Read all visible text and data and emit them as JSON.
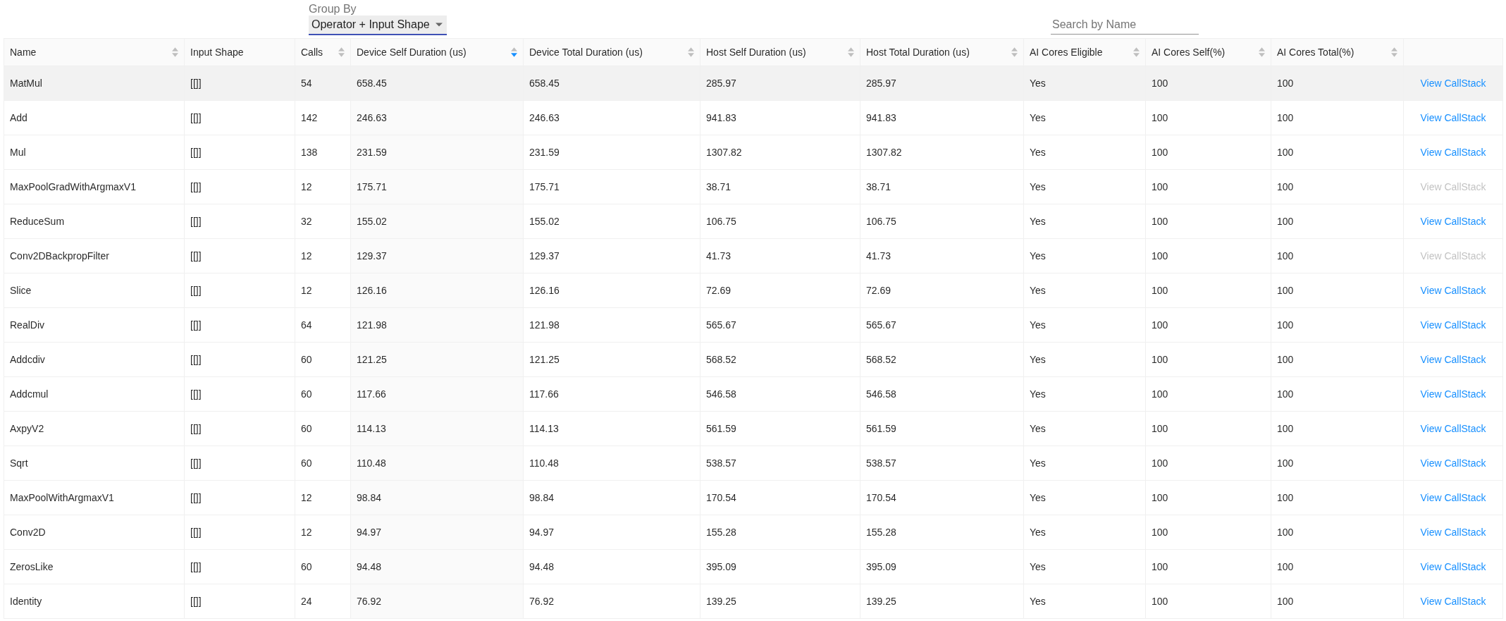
{
  "group_by": {
    "label": "Group By",
    "value": "Operator + Input Shape"
  },
  "search": {
    "placeholder": "Search by Name"
  },
  "table": {
    "columns": [
      {
        "label": "Name",
        "sortable": true,
        "sorted": false
      },
      {
        "label": "Input Shape",
        "sortable": false
      },
      {
        "label": "Calls",
        "sortable": true,
        "sorted": false
      },
      {
        "label": "Device Self Duration (us)",
        "sortable": true,
        "sorted": true
      },
      {
        "label": "Device Total Duration (us)",
        "sortable": true,
        "sorted": false
      },
      {
        "label": "Host Self Duration (us)",
        "sortable": true,
        "sorted": false
      },
      {
        "label": "Host Total Duration (us)",
        "sortable": true,
        "sorted": false
      },
      {
        "label": "AI Cores Eligible",
        "sortable": true,
        "sorted": false
      },
      {
        "label": "AI Cores Self(%)",
        "sortable": true,
        "sorted": false
      },
      {
        "label": "AI Cores Total(%)",
        "sortable": true,
        "sorted": false
      }
    ],
    "rows": [
      {
        "highlighted": true,
        "cells": [
          "MatMul",
          "[[]]",
          "54",
          "658.45",
          "658.45",
          "285.97",
          "285.97",
          "Yes",
          "100",
          "100"
        ],
        "action": {
          "label": "View CallStack",
          "disabled": false
        }
      },
      {
        "highlighted": false,
        "cells": [
          "Add",
          "[[]]",
          "142",
          "246.63",
          "246.63",
          "941.83",
          "941.83",
          "Yes",
          "100",
          "100"
        ],
        "action": {
          "label": "View CallStack",
          "disabled": false
        }
      },
      {
        "highlighted": false,
        "cells": [
          "Mul",
          "[[]]",
          "138",
          "231.59",
          "231.59",
          "1307.82",
          "1307.82",
          "Yes",
          "100",
          "100"
        ],
        "action": {
          "label": "View CallStack",
          "disabled": false
        }
      },
      {
        "highlighted": false,
        "cells": [
          "MaxPoolGradWithArgmaxV1",
          "[[]]",
          "12",
          "175.71",
          "175.71",
          "38.71",
          "38.71",
          "Yes",
          "100",
          "100"
        ],
        "action": {
          "label": "View CallStack",
          "disabled": true
        }
      },
      {
        "highlighted": false,
        "cells": [
          "ReduceSum",
          "[[]]",
          "32",
          "155.02",
          "155.02",
          "106.75",
          "106.75",
          "Yes",
          "100",
          "100"
        ],
        "action": {
          "label": "View CallStack",
          "disabled": false
        }
      },
      {
        "highlighted": false,
        "cells": [
          "Conv2DBackpropFilter",
          "[[]]",
          "12",
          "129.37",
          "129.37",
          "41.73",
          "41.73",
          "Yes",
          "100",
          "100"
        ],
        "action": {
          "label": "View CallStack",
          "disabled": true
        }
      },
      {
        "highlighted": false,
        "cells": [
          "Slice",
          "[[]]",
          "12",
          "126.16",
          "126.16",
          "72.69",
          "72.69",
          "Yes",
          "100",
          "100"
        ],
        "action": {
          "label": "View CallStack",
          "disabled": false
        }
      },
      {
        "highlighted": false,
        "cells": [
          "RealDiv",
          "[[]]",
          "64",
          "121.98",
          "121.98",
          "565.67",
          "565.67",
          "Yes",
          "100",
          "100"
        ],
        "action": {
          "label": "View CallStack",
          "disabled": false
        }
      },
      {
        "highlighted": false,
        "cells": [
          "Addcdiv",
          "[[]]",
          "60",
          "121.25",
          "121.25",
          "568.52",
          "568.52",
          "Yes",
          "100",
          "100"
        ],
        "action": {
          "label": "View CallStack",
          "disabled": false
        }
      },
      {
        "highlighted": false,
        "cells": [
          "Addcmul",
          "[[]]",
          "60",
          "117.66",
          "117.66",
          "546.58",
          "546.58",
          "Yes",
          "100",
          "100"
        ],
        "action": {
          "label": "View CallStack",
          "disabled": false
        }
      },
      {
        "highlighted": false,
        "cells": [
          "AxpyV2",
          "[[]]",
          "60",
          "114.13",
          "114.13",
          "561.59",
          "561.59",
          "Yes",
          "100",
          "100"
        ],
        "action": {
          "label": "View CallStack",
          "disabled": false
        }
      },
      {
        "highlighted": false,
        "cells": [
          "Sqrt",
          "[[]]",
          "60",
          "110.48",
          "110.48",
          "538.57",
          "538.57",
          "Yes",
          "100",
          "100"
        ],
        "action": {
          "label": "View CallStack",
          "disabled": false
        }
      },
      {
        "highlighted": false,
        "cells": [
          "MaxPoolWithArgmaxV1",
          "[[]]",
          "12",
          "98.84",
          "98.84",
          "170.54",
          "170.54",
          "Yes",
          "100",
          "100"
        ],
        "action": {
          "label": "View CallStack",
          "disabled": false
        }
      },
      {
        "highlighted": false,
        "cells": [
          "Conv2D",
          "[[]]",
          "12",
          "94.97",
          "94.97",
          "155.28",
          "155.28",
          "Yes",
          "100",
          "100"
        ],
        "action": {
          "label": "View CallStack",
          "disabled": false
        }
      },
      {
        "highlighted": false,
        "cells": [
          "ZerosLike",
          "[[]]",
          "60",
          "94.48",
          "94.48",
          "395.09",
          "395.09",
          "Yes",
          "100",
          "100"
        ],
        "action": {
          "label": "View CallStack",
          "disabled": false
        }
      },
      {
        "highlighted": false,
        "cells": [
          "Identity",
          "[[]]",
          "24",
          "76.92",
          "76.92",
          "139.25",
          "139.25",
          "Yes",
          "100",
          "100"
        ],
        "action": {
          "label": "View CallStack",
          "disabled": false
        }
      }
    ]
  }
}
